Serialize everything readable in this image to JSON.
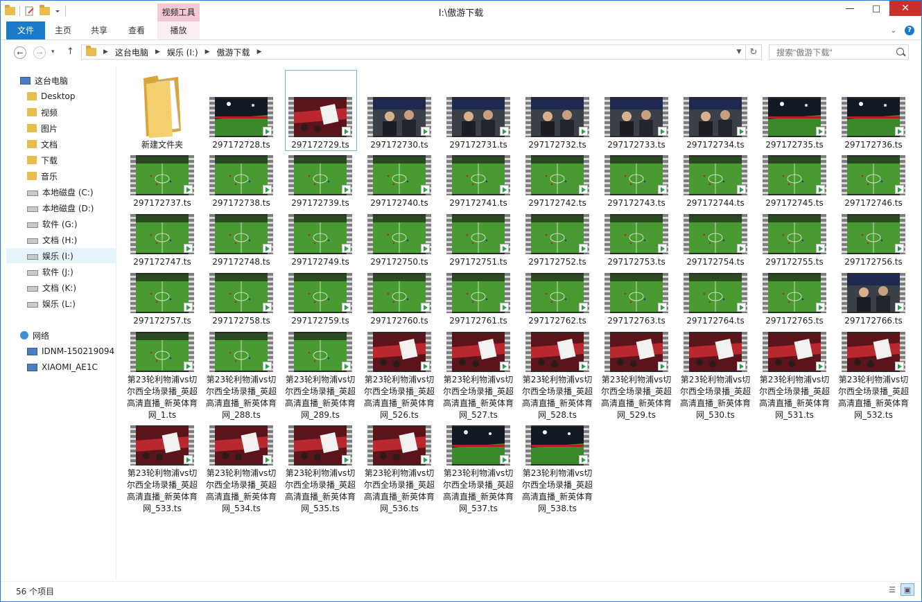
{
  "window": {
    "title": "I:\\傲游下载",
    "context_tab_group": "视频工具"
  },
  "ribbon": {
    "tabs": [
      "文件",
      "主页",
      "共享",
      "查看",
      "播放"
    ]
  },
  "address": {
    "crumbs": [
      "这台电脑",
      "娱乐 (I:)",
      "傲游下载"
    ],
    "search_placeholder": "搜索\"傲游下载\""
  },
  "sidebar": {
    "items": [
      {
        "label": "这台电脑",
        "icon": "pc-icon",
        "level": 0
      },
      {
        "label": "Desktop",
        "icon": "desktop-folder-icon",
        "level": 1
      },
      {
        "label": "视频",
        "icon": "videos-folder-icon",
        "level": 1
      },
      {
        "label": "图片",
        "icon": "pictures-folder-icon",
        "level": 1
      },
      {
        "label": "文档",
        "icon": "documents-folder-icon",
        "level": 1
      },
      {
        "label": "下载",
        "icon": "downloads-folder-icon",
        "level": 1
      },
      {
        "label": "音乐",
        "icon": "music-folder-icon",
        "level": 1
      },
      {
        "label": "本地磁盘 (C:)",
        "icon": "system-drive-icon",
        "level": 1
      },
      {
        "label": "本地磁盘 (D:)",
        "icon": "drive-icon",
        "level": 1
      },
      {
        "label": "软件 (G:)",
        "icon": "drive-icon",
        "level": 1
      },
      {
        "label": "文档 (H:)",
        "icon": "drive-icon",
        "level": 1
      },
      {
        "label": "娱乐 (I:)",
        "icon": "drive-icon",
        "level": 1,
        "selected": true
      },
      {
        "label": "软件 (J:)",
        "icon": "drive-icon",
        "level": 1
      },
      {
        "label": "文档 (K:)",
        "icon": "drive-icon",
        "level": 1
      },
      {
        "label": "娱乐 (L:)",
        "icon": "drive-icon",
        "level": 1
      },
      {
        "label": "网络",
        "icon": "network-icon",
        "level": 0
      },
      {
        "label": "IDNM-150219094",
        "icon": "computer-icon",
        "level": 1
      },
      {
        "label": "XIAOMI_AE1C",
        "icon": "computer-icon",
        "level": 1
      }
    ]
  },
  "files": {
    "folder": "新建文件夹",
    "row1": [
      "297172728.ts",
      "297172729.ts",
      "297172730.ts",
      "297172731.ts",
      "297172732.ts",
      "297172733.ts",
      "297172734.ts",
      "297172735.ts",
      "297172736.ts"
    ],
    "row2": [
      "297172737.ts",
      "297172738.ts",
      "297172739.ts",
      "297172740.ts",
      "297172741.ts",
      "297172742.ts",
      "297172743.ts",
      "297172744.ts",
      "297172745.ts",
      "297172746.ts"
    ],
    "row3": [
      "297172747.ts",
      "297172748.ts",
      "297172749.ts",
      "297172750.ts",
      "297172751.ts",
      "297172752.ts",
      "297172753.ts",
      "297172754.ts",
      "297172755.ts",
      "297172756.ts"
    ],
    "row4": [
      "297172757.ts",
      "297172758.ts",
      "297172759.ts",
      "297172760.ts",
      "297172761.ts",
      "297172762.ts",
      "297172763.ts",
      "297172764.ts",
      "297172765.ts",
      "297172766.ts"
    ],
    "row5": [
      "第23轮利物浦vs切尔西全场录播_英超高清直播_新英体育网_1.ts",
      "第23轮利物浦vs切尔西全场录播_英超高清直播_新英体育网_288.ts",
      "第23轮利物浦vs切尔西全场录播_英超高清直播_新英体育网_289.ts",
      "第23轮利物浦vs切尔西全场录播_英超高清直播_新英体育网_526.ts",
      "第23轮利物浦vs切尔西全场录播_英超高清直播_新英体育网_527.ts",
      "第23轮利物浦vs切尔西全场录播_英超高清直播_新英体育网_528.ts",
      "第23轮利物浦vs切尔西全场录播_英超高清直播_新英体育网_529.ts",
      "第23轮利物浦vs切尔西全场录播_英超高清直播_新英体育网_530.ts",
      "第23轮利物浦vs切尔西全场录播_英超高清直播_新英体育网_531.ts",
      "第23轮利物浦vs切尔西全场录播_英超高清直播_新英体育网_532.ts"
    ],
    "row6": [
      "第23轮利物浦vs切尔西全场录播_英超高清直播_新英体育网_533.ts",
      "第23轮利物浦vs切尔西全场录播_英超高清直播_新英体育网_534.ts",
      "第23轮利物浦vs切尔西全场录播_英超高清直播_新英体育网_535.ts",
      "第23轮利物浦vs切尔西全场录播_英超高清直播_新英体育网_536.ts",
      "第23轮利物浦vs切尔西全场录播_英超高清直播_新英体育网_537.ts",
      "第23轮利物浦vs切尔西全场录播_英超高清直播_新英体育网_538.ts"
    ],
    "selected": "297172729.ts"
  },
  "status": {
    "count": "56 个项目"
  },
  "colors": {
    "accent": "#1979ca",
    "context_tab": "#f4c8d8",
    "close": "#c9302c",
    "pitch": "#3f8f2a",
    "crowd": "#6b1a1e"
  }
}
